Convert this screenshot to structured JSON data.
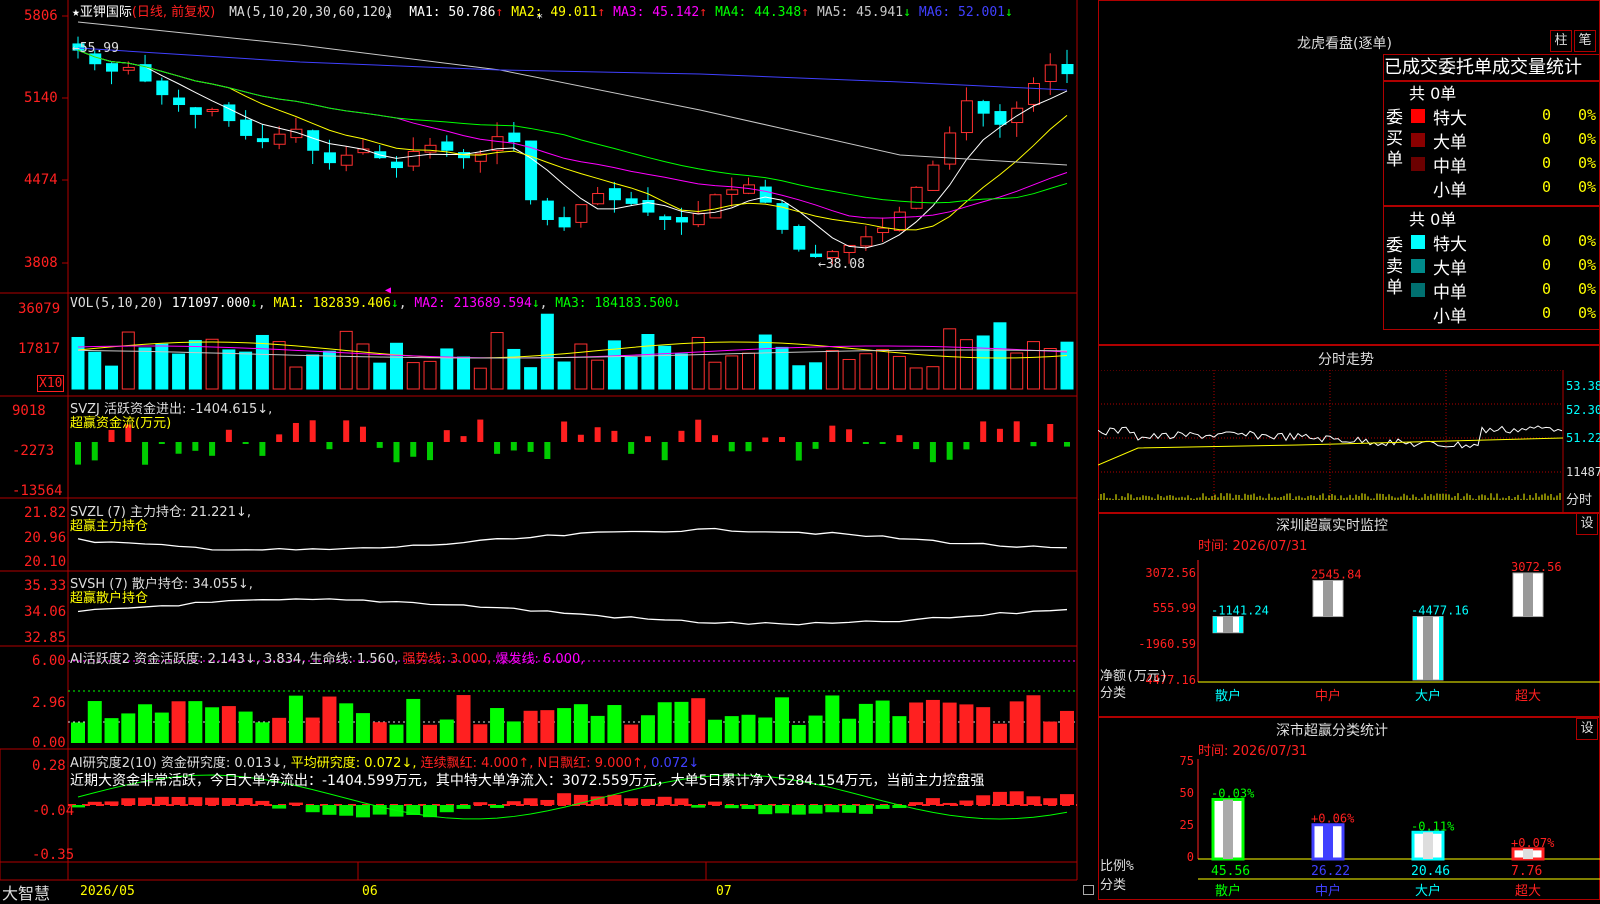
{
  "app": {
    "name": "大智慧"
  },
  "stock": {
    "star": "★",
    "name": "亚钾国际",
    "period": "(日线, 前复权)"
  },
  "ma_header": {
    "params": "MA(5,10,20,30,60,120)",
    "items": [
      {
        "label": "MA1: 50.786",
        "arrow": "↑",
        "color": "#ffffff"
      },
      {
        "label": "MA2: 49.011",
        "arrow": "↑",
        "color": "#ffff00"
      },
      {
        "label": "MA3: 45.142",
        "arrow": "↑",
        "color": "#ff00ff"
      },
      {
        "label": "MA4: 44.348",
        "arrow": "↑",
        "color": "#00ff00"
      },
      {
        "label": "MA5: 45.941",
        "arrow": "↓",
        "color": "#c8c8c8"
      },
      {
        "label": "MA6: 52.001",
        "arrow": "↓",
        "color": "#4040ff"
      }
    ]
  },
  "price_axis": {
    "ticks": [
      "5806",
      "5140",
      "4474",
      "3808"
    ],
    "high_label": "←55.99",
    "low_label": "←38.08"
  },
  "vol": {
    "header": "VOL(5,10,20)",
    "value": "171097.000",
    "ma1": "MA1: 182839.406",
    "ma2": "MA2: 213689.594",
    "ma3": "MA3: 184183.500",
    "ticks": [
      "36079",
      "17817"
    ],
    "unit": "X10"
  },
  "svzj": {
    "header": "SVZJ  活跃资金进出: -1404.615↓,",
    "sub": "超赢资金流(万元)",
    "ticks": [
      "9018",
      "-2273",
      "-13564"
    ]
  },
  "svzl": {
    "header": "SVZL (7) 主力持仓: 21.221↓,",
    "sub": "超赢主力持仓",
    "ticks": [
      "21.82",
      "20.96",
      "20.10"
    ]
  },
  "svsh": {
    "header": "SVSH (7) 散户持仓: 34.055↓,",
    "sub": "超赢散户持仓",
    "ticks": [
      "35.33",
      "34.06",
      "32.85"
    ]
  },
  "ai_active": {
    "header": "AI活跃度2 资金活跃度: 2.143↓, 3.834, 生命线: 1.560,",
    "strong": "强势线: 3.000,",
    "burst": "爆发线: 6.000,",
    "ticks": [
      "6.00",
      "2.96",
      "0.00"
    ]
  },
  "ai_research": {
    "header": "AI研究度2(10) 资金研究度: 0.013↓,",
    "avg": "平均研究度: 0.072↓,",
    "lianxu": "连续飘红: 4.000↑,",
    "nday": "N日飘红: 9.000↑,",
    "last": "0.072↓",
    "ticks": [
      "0.28",
      "-0.04",
      "-0.35"
    ],
    "commentary": "近期大资金非常活跃，今日大单净流出：-1404.599万元，其中特大单净流入：3072.559万元，大单5日累计净入5284.154万元，当前主力控盘强"
  },
  "xaxis": {
    "labels": [
      "2026/05",
      "06",
      "07"
    ]
  },
  "dragon": {
    "title": "龙虎看盘(逐单)",
    "btn_zhu": "柱",
    "btn_bi": "笔",
    "tabs": [
      "已成交",
      "委托单",
      "成交量统计"
    ],
    "buy": {
      "side": "委买单",
      "total": "共 0单",
      "rows": [
        {
          "name": "特大",
          "v": "0",
          "p": "0%",
          "color": "#ff0000"
        },
        {
          "name": "大单",
          "v": "0",
          "p": "0%",
          "color": "#8b0000"
        },
        {
          "name": "中单",
          "v": "0",
          "p": "0%",
          "color": "#6b0000"
        },
        {
          "name": "小单",
          "v": "0",
          "p": "0%",
          "color": "#000000"
        }
      ]
    },
    "sell": {
      "side": "委卖单",
      "total": "共 0单",
      "rows": [
        {
          "name": "特大",
          "v": "0",
          "p": "0%",
          "color": "#00ffff"
        },
        {
          "name": "大单",
          "v": "0",
          "p": "0%",
          "color": "#008b8b"
        },
        {
          "name": "中单",
          "v": "0",
          "p": "0%",
          "color": "#007070"
        },
        {
          "name": "小单",
          "v": "0",
          "p": "0%",
          "color": "#000000"
        }
      ]
    }
  },
  "intraday": {
    "title": "分时走势",
    "ticks": [
      "53.38",
      "52.30",
      "51.22",
      "11487"
    ],
    "bottom": "分时"
  },
  "sz_monitor": {
    "title": "深圳超赢实时监控",
    "btn": "设",
    "time": "时间: 2026/07/31",
    "ticks": [
      "3072.56",
      "555.99",
      "-1960.59",
      "-4477.16"
    ],
    "ylabel": "净额(万元)",
    "xlabel": "分类",
    "cats": [
      "散户",
      "中户",
      "大户",
      "超大"
    ],
    "bars": [
      {
        "value": -1141.24,
        "label": "-1141.24"
      },
      {
        "value": 2545.84,
        "label": "2545.84"
      },
      {
        "value": -4477.16,
        "label": "-4477.16"
      },
      {
        "value": 3072.56,
        "label": "3072.56"
      }
    ]
  },
  "sz_stats": {
    "title": "深市超赢分类统计",
    "btn": "设",
    "time": "时间: 2026/07/31",
    "ticks": [
      "75",
      "50",
      "25",
      "0"
    ],
    "ylabel": "比例%",
    "xlabel": "分类",
    "cats": [
      "散户",
      "中户",
      "大户",
      "超大"
    ],
    "bars": [
      {
        "value": 45.56,
        "label": "45.56",
        "chg": "-0.03%"
      },
      {
        "value": 26.22,
        "label": "26.22",
        "chg": "+0.06%"
      },
      {
        "value": 20.46,
        "label": "20.46",
        "chg": "-0.11%"
      },
      {
        "value": 7.76,
        "label": "7.76",
        "chg": "+0.07%"
      }
    ]
  }
}
